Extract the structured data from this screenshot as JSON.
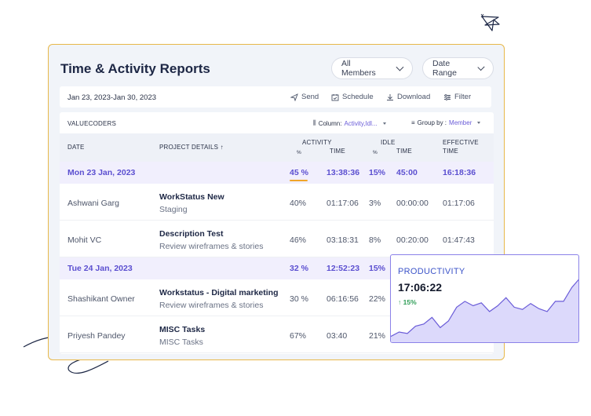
{
  "header": {
    "title": "Time & Activity Reports",
    "members_filter": "All Members",
    "date_filter": "Date Range"
  },
  "toolbar": {
    "date_range": "Jan 23, 2023-Jan 30, 2023",
    "send": "Send",
    "schedule": "Schedule",
    "download": "Download",
    "filter": "Filter"
  },
  "table": {
    "org": "VALUECODERS",
    "column_label": "Column:",
    "column_value": "Activity,Idl...",
    "group_label": "Group by :",
    "group_value": "Member",
    "headers": {
      "date": "DATE",
      "project": "PROJECT DETAILS ↑",
      "activity": "ACTIVITY",
      "activity_pct": "%",
      "activity_time": "TIME",
      "idle": "IDLE",
      "idle_pct": "%",
      "idle_time": "TIME",
      "effective": "EFFECTIVE",
      "effective_time": "TIME"
    },
    "groups": [
      {
        "date": "Mon 23 Jan, 2023",
        "activity_pct": "45 %",
        "activity_time": "13:38:36",
        "idle_pct": "15%",
        "idle_time": "45:00",
        "effective_time": "16:18:36",
        "rows": [
          {
            "name": "Ashwani Garg",
            "project": "WorkStatus New",
            "task": "Staging",
            "activity_pct": "40%",
            "activity_time": "01:17:06",
            "idle_pct": "3%",
            "idle_time": "00:00:00",
            "effective_time": "01:17:06"
          },
          {
            "name": "Mohit VC",
            "project": "Description Test",
            "task": "Review wireframes & stories",
            "activity_pct": "46%",
            "activity_time": "03:18:31",
            "idle_pct": "8%",
            "idle_time": "00:20:00",
            "effective_time": "01:47:43"
          }
        ]
      },
      {
        "date": "Tue 24 Jan, 2023",
        "activity_pct": "32 %",
        "activity_time": "12:52:23",
        "idle_pct": "15%",
        "rows": [
          {
            "name": "Shashikant Owner",
            "project": "Workstatus - Digital marketing",
            "task": "Review wireframes & stories",
            "activity_pct": "30 %",
            "activity_time": "06:16:56",
            "idle_pct": "22%"
          },
          {
            "name": "Priyesh Pandey",
            "project": "MISC Tasks",
            "task": "MISC Tasks",
            "activity_pct": "67%",
            "activity_time": "03:40",
            "idle_pct": "21%"
          }
        ]
      }
    ]
  },
  "productivity": {
    "label": "PRODUCTIVITY",
    "time": "17:06:22",
    "change": "↑ 15%",
    "colors": {
      "line": "#6a5cd8",
      "fill": "#dcd9fb"
    },
    "series": [
      8,
      14,
      12,
      22,
      25,
      34,
      20,
      29,
      48,
      56,
      50,
      54,
      42,
      50,
      61,
      48,
      45,
      53,
      46,
      42,
      56,
      56,
      75,
      88
    ]
  },
  "colors": {
    "accent": "#5b4fd0",
    "border": "#e8b84a",
    "highlight": "#f0a52a"
  }
}
